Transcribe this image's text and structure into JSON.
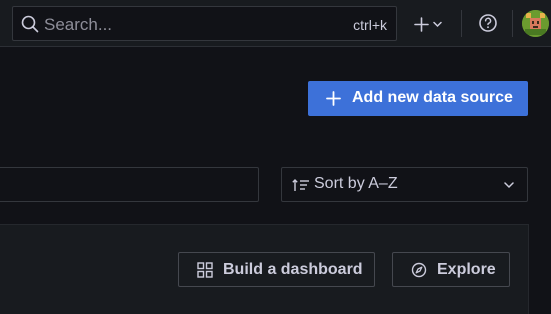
{
  "search": {
    "placeholder": "Search...",
    "shortcut": "ctrl+k"
  },
  "header": {
    "add_menu_icon": "plus-icon",
    "help_icon": "help-circle-icon",
    "avatar_icon": "user-avatar"
  },
  "actions": {
    "add_data_source": "Add new data source"
  },
  "filters": {
    "sort_label": "Sort by A–Z"
  },
  "empty_state": {
    "build_dashboard": "Build a dashboard",
    "explore": "Explore"
  },
  "colors": {
    "primary": "#3d71d9",
    "background": "#111217",
    "panel": "#181b1f",
    "text": "#ccccdc"
  }
}
